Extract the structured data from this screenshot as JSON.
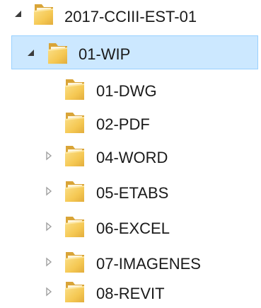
{
  "tree": {
    "root": {
      "label": "2017-CCIII-EST-01",
      "state": "expanded"
    },
    "selected": {
      "label": "01-WIP",
      "state": "expanded"
    },
    "children": [
      {
        "label": "01-DWG",
        "state": "leaf"
      },
      {
        "label": "02-PDF",
        "state": "leaf"
      },
      {
        "label": "04-WORD",
        "state": "collapsed"
      },
      {
        "label": "05-ETABS",
        "state": "collapsed"
      },
      {
        "label": "06-EXCEL",
        "state": "collapsed"
      },
      {
        "label": "07-IMAGENES",
        "state": "collapsed"
      },
      {
        "label": "08-REVIT",
        "state": "collapsed"
      }
    ]
  },
  "colors": {
    "selection_fill": "#cce8ff",
    "selection_border": "#99d1ff",
    "folder_body": "#f5cb5c",
    "folder_shade": "#d9a437",
    "expanded_arrow": "#3c3c3c",
    "collapsed_arrow": "#a0a0a0"
  },
  "icons": {
    "folder": "folder-icon",
    "expanded": "expanded-triangle-icon",
    "collapsed": "collapsed-triangle-icon"
  }
}
